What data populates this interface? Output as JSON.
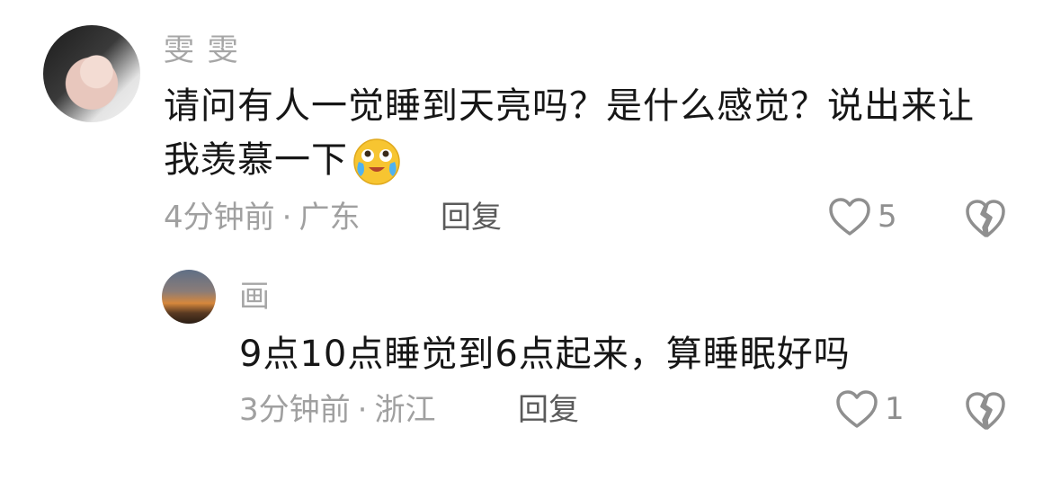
{
  "comments": [
    {
      "username": "雯 雯",
      "content": "请问有人一觉睡到天亮吗？是什么感觉？说出来让我羡慕一下",
      "emoji": "crying-laughing-emoji",
      "time": "4分钟前",
      "separator": "·",
      "location": "广东",
      "reply_label": "回复",
      "like_count": "5",
      "icons": {
        "like": "heart-outline-icon",
        "dislike": "broken-heart-icon"
      }
    },
    {
      "username": "画",
      "content": "9点10点睡觉到6点起来，算睡眠好吗",
      "time": "3分钟前",
      "separator": "·",
      "location": "浙江",
      "reply_label": "回复",
      "like_count": "1",
      "icons": {
        "like": "heart-outline-icon",
        "dislike": "broken-heart-icon"
      }
    }
  ],
  "colors": {
    "text_primary": "#161616",
    "text_muted": "#a0a0a0",
    "reply_text": "#5a5a5a",
    "icon_gray": "#8f8f8f"
  }
}
